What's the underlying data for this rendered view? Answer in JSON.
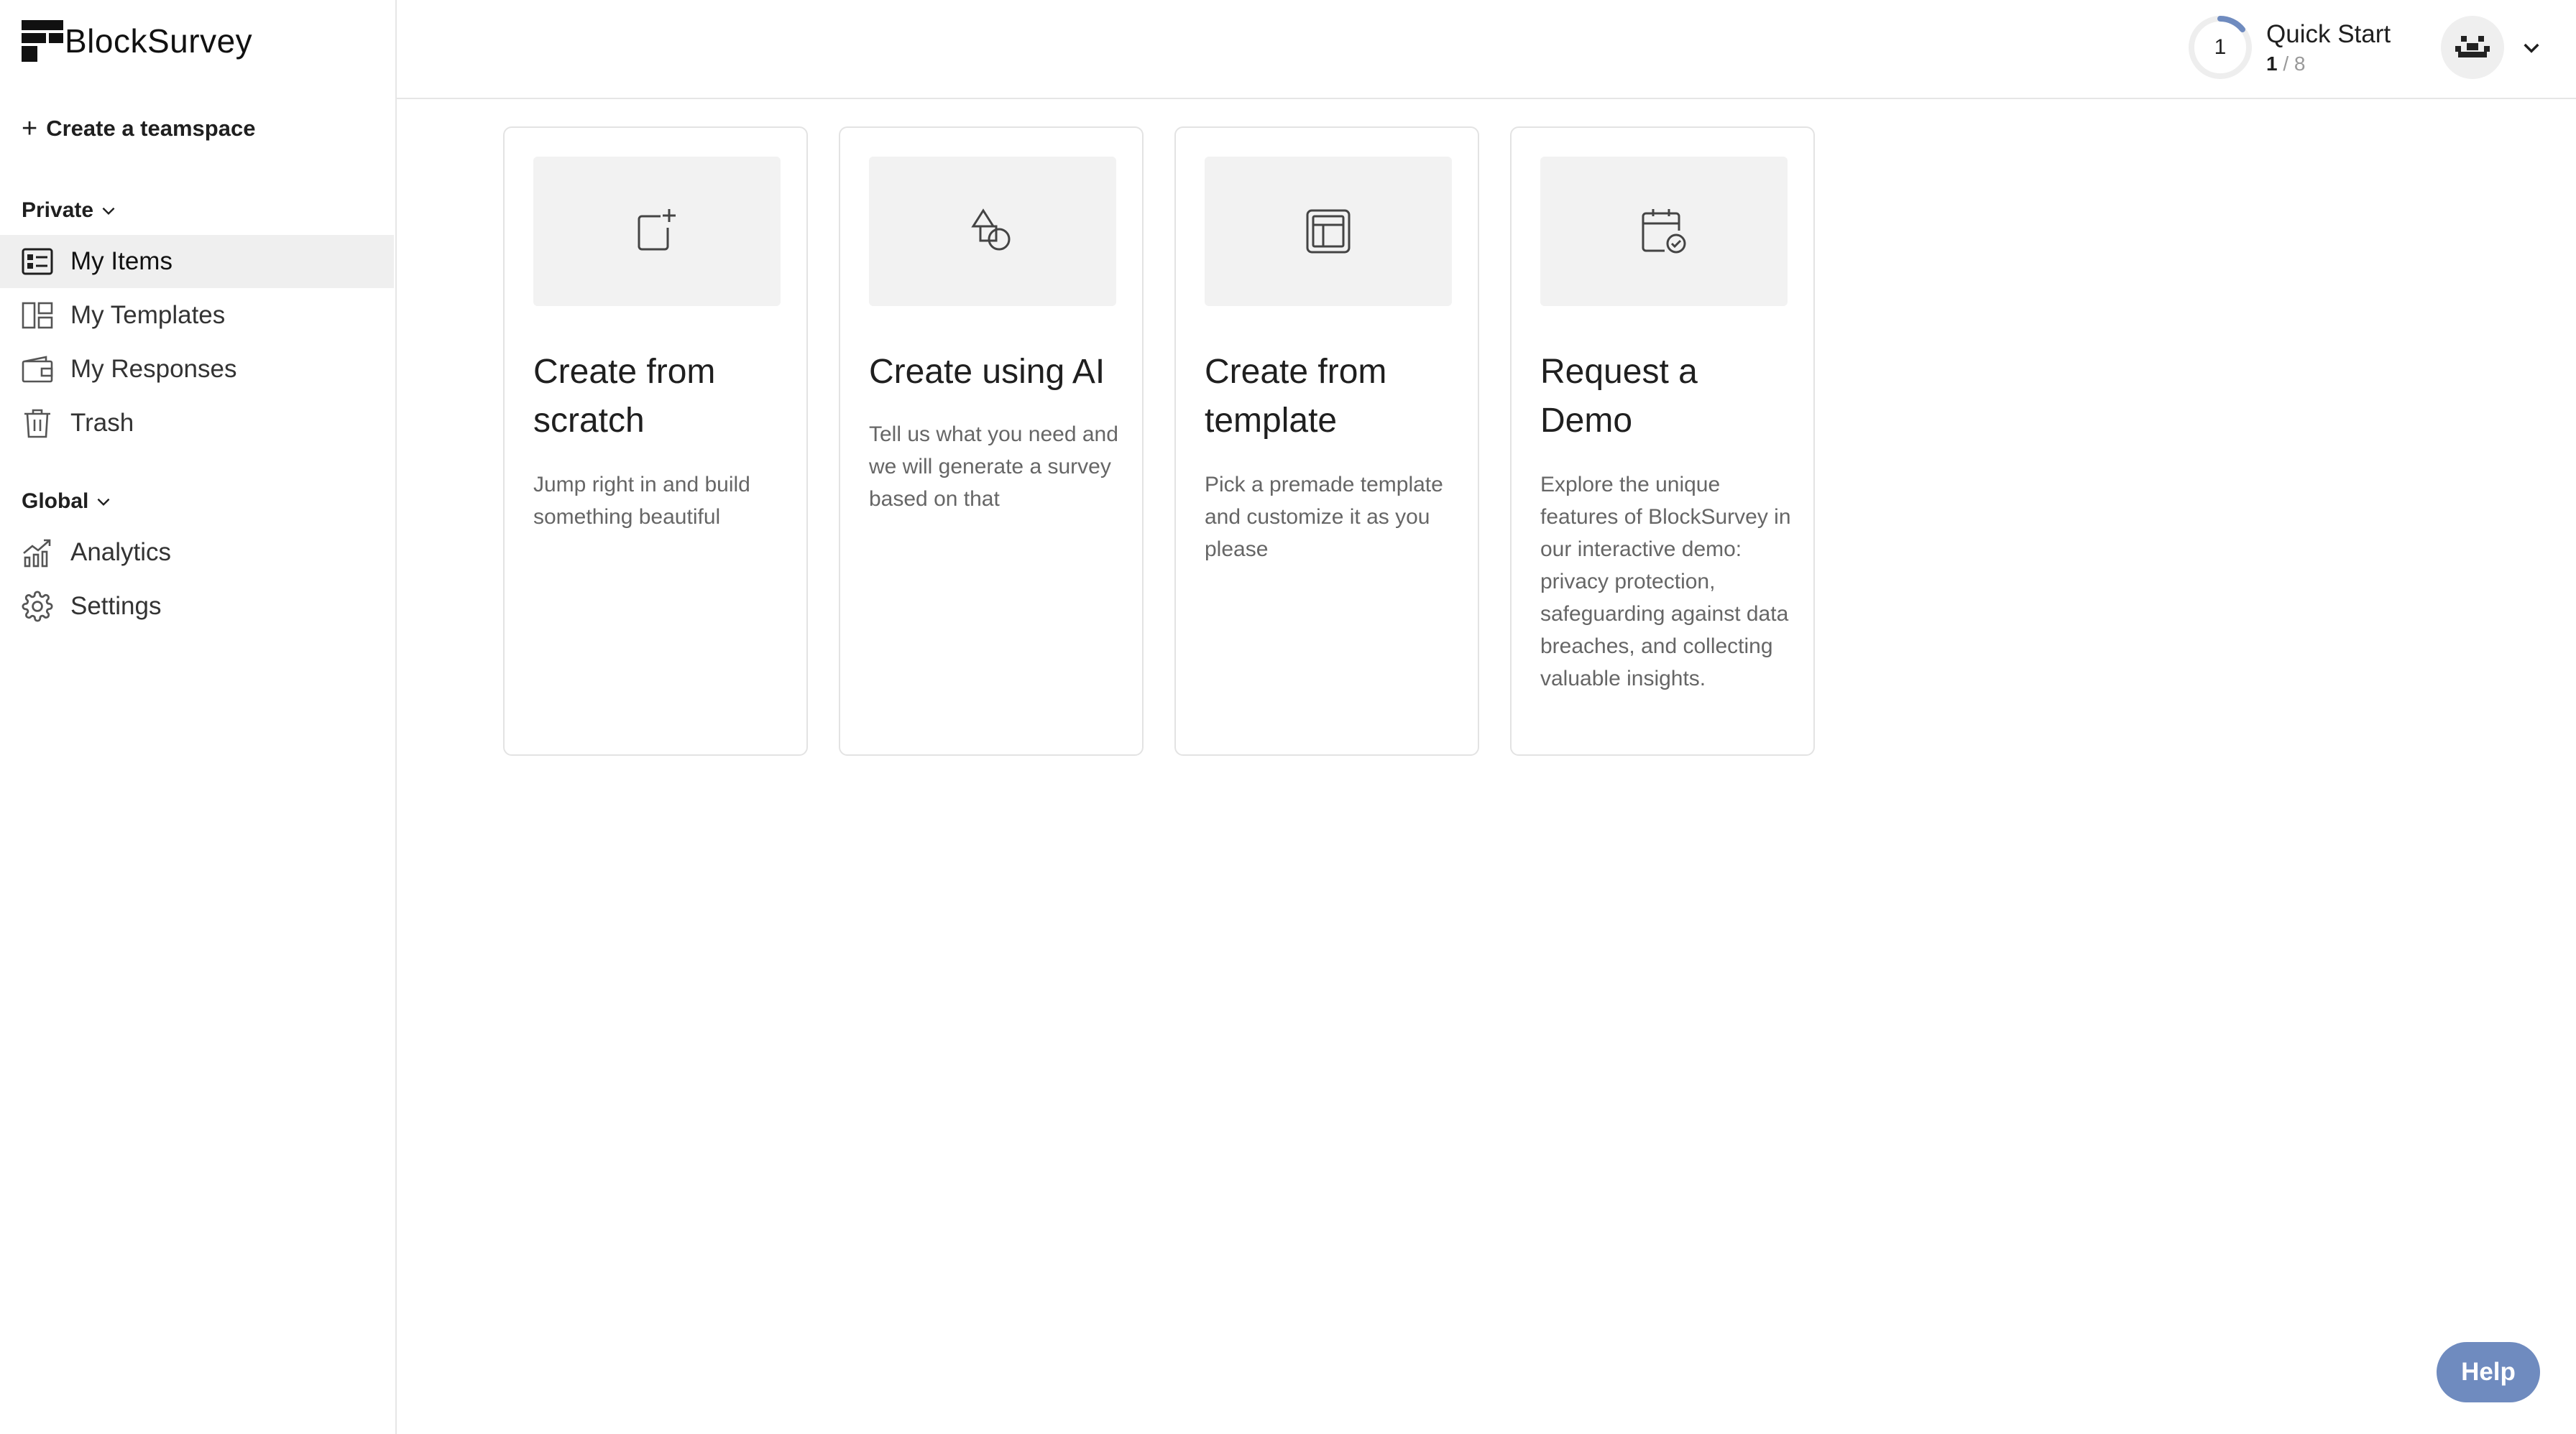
{
  "app": {
    "name": "BlockSurvey"
  },
  "sidebar": {
    "create_teamspace": "Create a teamspace",
    "private_label": "Private",
    "global_label": "Global",
    "private_items": [
      {
        "label": "My Items",
        "icon": "list-icon",
        "active": true
      },
      {
        "label": "My Templates",
        "icon": "templates-icon",
        "active": false
      },
      {
        "label": "My Responses",
        "icon": "wallet-icon",
        "active": false
      },
      {
        "label": "Trash",
        "icon": "trash-icon",
        "active": false
      }
    ],
    "global_items": [
      {
        "label": "Analytics",
        "icon": "chart-icon"
      },
      {
        "label": "Settings",
        "icon": "gear-icon"
      }
    ]
  },
  "header": {
    "quick_start": {
      "title": "Quick Start",
      "step": "1",
      "done": "1",
      "separator": " / ",
      "total": "8"
    }
  },
  "cards": [
    {
      "title": "Create from scratch",
      "description": "Jump right in and build something beautiful",
      "icon": "add-document-icon"
    },
    {
      "title": "Create using AI",
      "description": "Tell us what you need and we will generate a survey based on that",
      "icon": "shapes-icon"
    },
    {
      "title": "Create from template",
      "description": "Pick a premade template and customize it as you please",
      "icon": "layout-icon"
    },
    {
      "title": "Request a Demo",
      "description": "Explore the unique features of BlockSurvey in our interactive demo: privacy protection, safeguarding against data breaches, and collecting valuable insights.",
      "icon": "calendar-check-icon"
    }
  ],
  "help_label": "Help",
  "colors": {
    "help_button": "#6f8bbf",
    "active_item_bg": "#efefef",
    "progress_ring": "#6f8bbf"
  }
}
